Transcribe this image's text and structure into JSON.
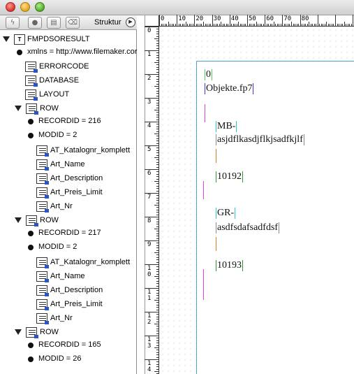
{
  "window": {
    "title": ""
  },
  "structure_panel": {
    "title": "Struktur",
    "toolbar_icons": [
      "lightning-icon",
      "record-icon",
      "new-node-icon",
      "trash-icon"
    ],
    "tree": [
      {
        "kind": "doc",
        "label": "FMPDSORESULT",
        "expanded": true
      },
      {
        "kind": "attr",
        "label": "xmlns = http://www.filemaker.cor"
      },
      {
        "kind": "element",
        "label": "ERRORCODE"
      },
      {
        "kind": "element",
        "label": "DATABASE"
      },
      {
        "kind": "element",
        "label": "LAYOUT"
      },
      {
        "kind": "element",
        "label": "ROW",
        "expanded": true
      },
      {
        "kind": "attr",
        "label": "RECORDID = 216"
      },
      {
        "kind": "attr",
        "label": "MODID = 2"
      },
      {
        "kind": "element",
        "label": "AT_Katalognr_komplett"
      },
      {
        "kind": "element",
        "label": "Art_Name"
      },
      {
        "kind": "element",
        "label": "Art_Description"
      },
      {
        "kind": "element",
        "label": "Art_Preis_Limit"
      },
      {
        "kind": "element",
        "label": "Art_Nr"
      },
      {
        "kind": "element",
        "label": "ROW",
        "expanded": true
      },
      {
        "kind": "attr",
        "label": "RECORDID = 217"
      },
      {
        "kind": "attr",
        "label": "MODID = 2"
      },
      {
        "kind": "element",
        "label": "AT_Katalognr_komplett"
      },
      {
        "kind": "element",
        "label": "Art_Name"
      },
      {
        "kind": "element",
        "label": "Art_Description"
      },
      {
        "kind": "element",
        "label": "Art_Preis_Limit"
      },
      {
        "kind": "element",
        "label": "Art_Nr"
      },
      {
        "kind": "element",
        "label": "ROW",
        "expanded": true
      },
      {
        "kind": "attr",
        "label": "RECORDID = 165"
      },
      {
        "kind": "attr",
        "label": "MODID = 26"
      }
    ]
  },
  "ruler": {
    "horizontal_labels": [
      "0",
      "10",
      "20",
      "30",
      "40",
      "50",
      "60",
      "70",
      "80"
    ],
    "vertical_labels": [
      "0",
      "1",
      "2",
      "3",
      "4",
      "5",
      "6",
      "7",
      "8",
      "9",
      "10",
      "11",
      "12",
      "13",
      "14"
    ]
  },
  "document": {
    "lines": [
      {
        "text": "0",
        "tag_color": "#5cc85c"
      },
      {
        "text": "Objekte.fp7",
        "tag_color": "#3a3ad8"
      },
      {
        "text": "MB-",
        "tag_color": "#2fc9c9"
      },
      {
        "text": "asjdflkasdjflkjsadfkjlf",
        "tag_color": "#888888"
      },
      {
        "text": "10192",
        "tag_color": "#2a9a2a"
      },
      {
        "text": "GR-",
        "tag_color": "#2fc9c9"
      },
      {
        "text": "asdfsdafsadfdsf",
        "tag_color": "#888888"
      },
      {
        "text": "10193",
        "tag_color": "#2a9a2a"
      }
    ],
    "row_marker_color": "#e040e0"
  }
}
